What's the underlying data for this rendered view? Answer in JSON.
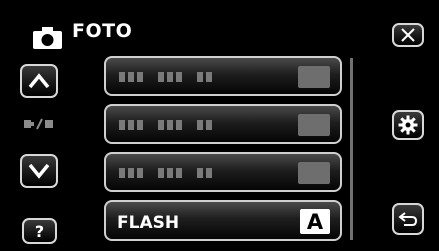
{
  "header": {
    "title": "FOTO",
    "icon": "camera-icon"
  },
  "left": {
    "up": "chevron-up-icon",
    "mode_indicator": "photo-video-switch-icon",
    "down": "chevron-down-icon",
    "help_label": "?"
  },
  "right": {
    "close": "close-icon",
    "settings": "gear-icon",
    "back": "return-icon"
  },
  "menu": {
    "rows": [
      {
        "label": "",
        "value": ""
      },
      {
        "label": "",
        "value": ""
      },
      {
        "label": "",
        "value": ""
      },
      {
        "label": "FLASH",
        "value": "A"
      }
    ]
  },
  "scrollbar": {
    "position": 1.0
  }
}
